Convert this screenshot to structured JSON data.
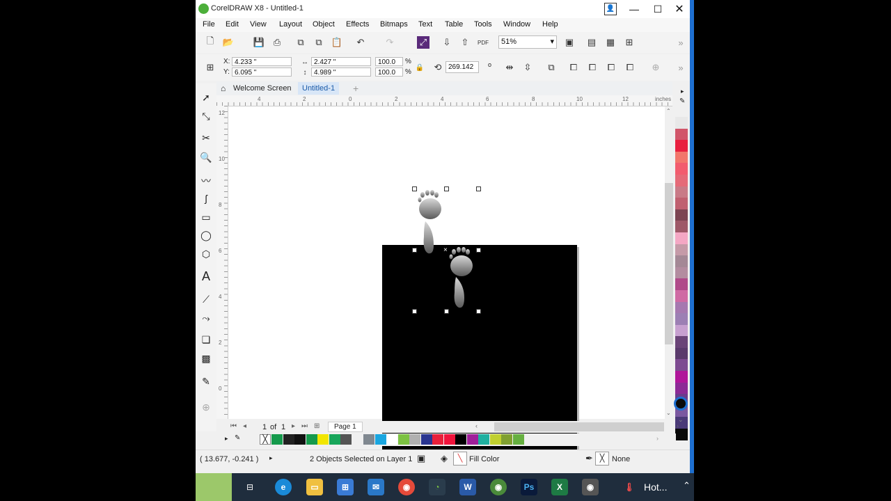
{
  "window": {
    "title": "CorelDRAW X8 - Untitled-1",
    "minimize": "—",
    "maximize": "☐",
    "close": "✕"
  },
  "menu": [
    "File",
    "Edit",
    "View",
    "Layout",
    "Object",
    "Effects",
    "Bitmaps",
    "Text",
    "Table",
    "Tools",
    "Window",
    "Help"
  ],
  "toolbar": {
    "zoom_value": "51%"
  },
  "properties": {
    "x_label": "X:",
    "x_value": "4.233 \"",
    "y_label": "Y:",
    "y_value": "6.095 \"",
    "w_value": "2.427 \"",
    "h_value": "4.989 \"",
    "scale_w": "100.0",
    "scale_h": "100.0",
    "pct1": "%",
    "pct2": "%",
    "rotation": "269.142",
    "degree": "o"
  },
  "tabs": {
    "welcome": "Welcome Screen",
    "doc": "Untitled-1",
    "add": "+"
  },
  "ruler": {
    "h_labels": [
      "4",
      "2",
      "0",
      "2",
      "4",
      "6",
      "8",
      "10",
      "12"
    ],
    "units": "inches",
    "v_labels": [
      "12",
      "10",
      "8",
      "6",
      "4",
      "2",
      "0"
    ]
  },
  "page_nav": {
    "current": "1",
    "of": "of",
    "total": "1",
    "page_tab": "Page 1"
  },
  "status": {
    "coords": "( 13.677, -0.241 )",
    "selection": "2 Objects Selected on Layer 1",
    "fill": "Fill Color",
    "outline": "None"
  },
  "palette_colors": [
    "#e8e8e8",
    "#d1566a",
    "#e8203f",
    "#f2766b",
    "#f25c6e",
    "#e56a78",
    "#c97a87",
    "#c06070",
    "#7c4452",
    "#9e5868",
    "#f4a7c4",
    "#c59aa8",
    "#a48896",
    "#b38ca0",
    "#b04a8a",
    "#cf6aa4",
    "#a678b0",
    "#9c7fb4",
    "#c7a0d0",
    "#6a4478",
    "#5a3a6c",
    "#7d4a91",
    "#b0169a",
    "#8c2a96",
    "#6c3c8c",
    "#7a58a0",
    "#4a3a78",
    "#0a0a0a"
  ],
  "doc_palette_colors": [
    "#159a4c",
    "#222222",
    "#111111",
    "#159a4c",
    "#f2e600",
    "#18a65a",
    "#555555",
    "#f0f0f0",
    "#808890",
    "#1aa6e0",
    "#ffffff",
    "#7cc242",
    "#b0b0b0",
    "#2a3590",
    "#e8203a",
    "#f0143c",
    "#000000",
    "#a0209a",
    "#20b0a0",
    "#c0d030",
    "#80a030",
    "#66b040"
  ],
  "taskbar": {
    "hot_label": "Hot..."
  }
}
